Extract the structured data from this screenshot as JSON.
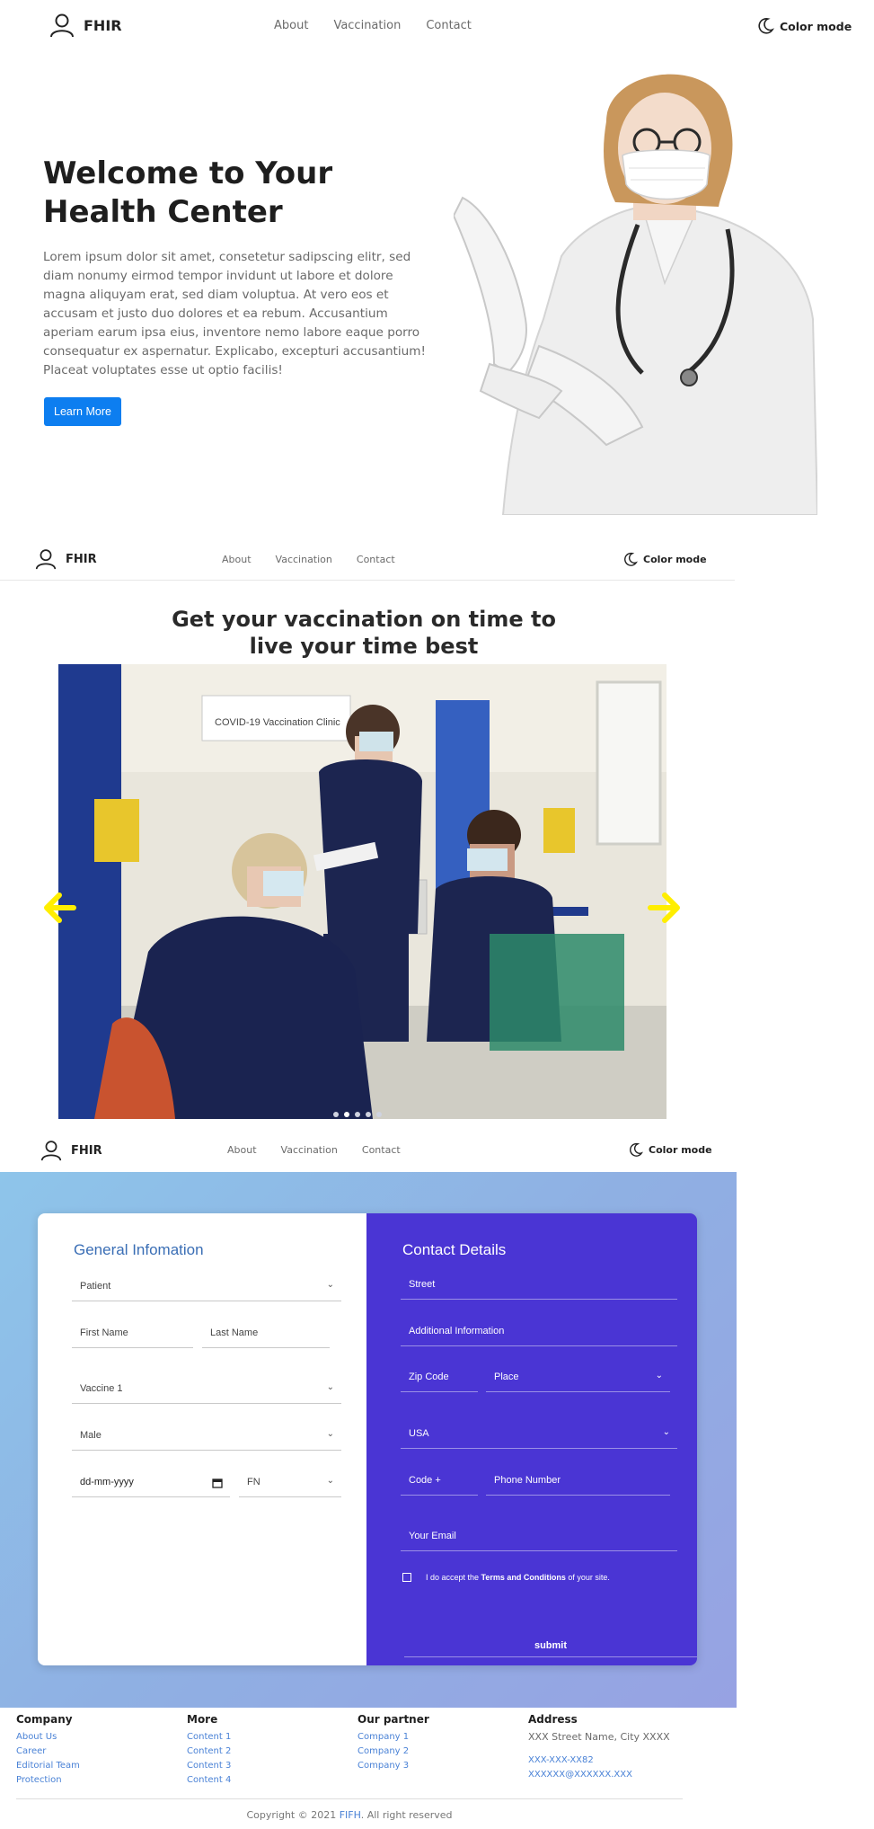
{
  "nav": {
    "brand": "FHIR",
    "links": [
      "About",
      "Vaccination",
      "Contact"
    ],
    "color_mode": "Color mode"
  },
  "hero": {
    "title": "Welcome to Your Health Center",
    "text": "Lorem ipsum dolor sit amet, consetetur sadipscing elitr, sed diam nonumy eirmod tempor invidunt ut labore et dolore magna aliquyam erat, sed diam voluptua. At vero eos et accusam et justo duo dolores et ea rebum. Accusantium aperiam earum ipsa eius, inventore nemo labore eaque porro consequatur ex aspernatur. Explicabo, excepturi accusantium! Placeat voluptates esse ut optio facilis!",
    "button": "Learn More"
  },
  "vaccination": {
    "heading": "Get your vaccination on time to live your time best",
    "sign_text": "COVID-19 Vaccination Clinic",
    "slides": 5,
    "active_slide": 1
  },
  "form": {
    "general": {
      "title": "General Infomation",
      "patient": "Patient",
      "first_name": "First Name",
      "last_name": "Last Name",
      "vaccine": "Vaccine 1",
      "gender": "Male",
      "date": "dd-mm-yyyy",
      "fn": "FN"
    },
    "contact": {
      "title": "Contact Details",
      "street": "Street",
      "additional": "Additional Information",
      "zip": "Zip Code",
      "place": "Place",
      "country": "USA",
      "code": "Code +",
      "phone": "Phone Number",
      "email": "Your Email",
      "terms_pre": "I do accept the ",
      "terms_link": "Terms and Conditions",
      "terms_post": " of your site.",
      "submit": "submit"
    }
  },
  "footer": {
    "company": {
      "title": "Company",
      "links": [
        "About Us",
        "Career",
        "Editorial Team",
        "Protection"
      ]
    },
    "more": {
      "title": "More",
      "links": [
        "Content 1",
        "Content 2",
        "Content 3",
        "Content 4"
      ]
    },
    "partner": {
      "title": "Our partner",
      "links": [
        "Company 1",
        "Company 2",
        "Company 3"
      ]
    },
    "address": {
      "title": "Address",
      "street": "XXX Street Name, City XXXX",
      "phone": "XXX-XXX-XX82",
      "email": "XXXXXX@XXXXXX.XXX"
    },
    "copyright_pre": "Copyright © 2021 ",
    "copyright_brand": "FIFH",
    "copyright_post": ". All right reserved"
  },
  "colors": {
    "accent_blue": "#0d7ef0",
    "form_panel": "#4a35d4",
    "arrow_yellow": "#ffee00",
    "link_blue": "#4a82d6"
  }
}
